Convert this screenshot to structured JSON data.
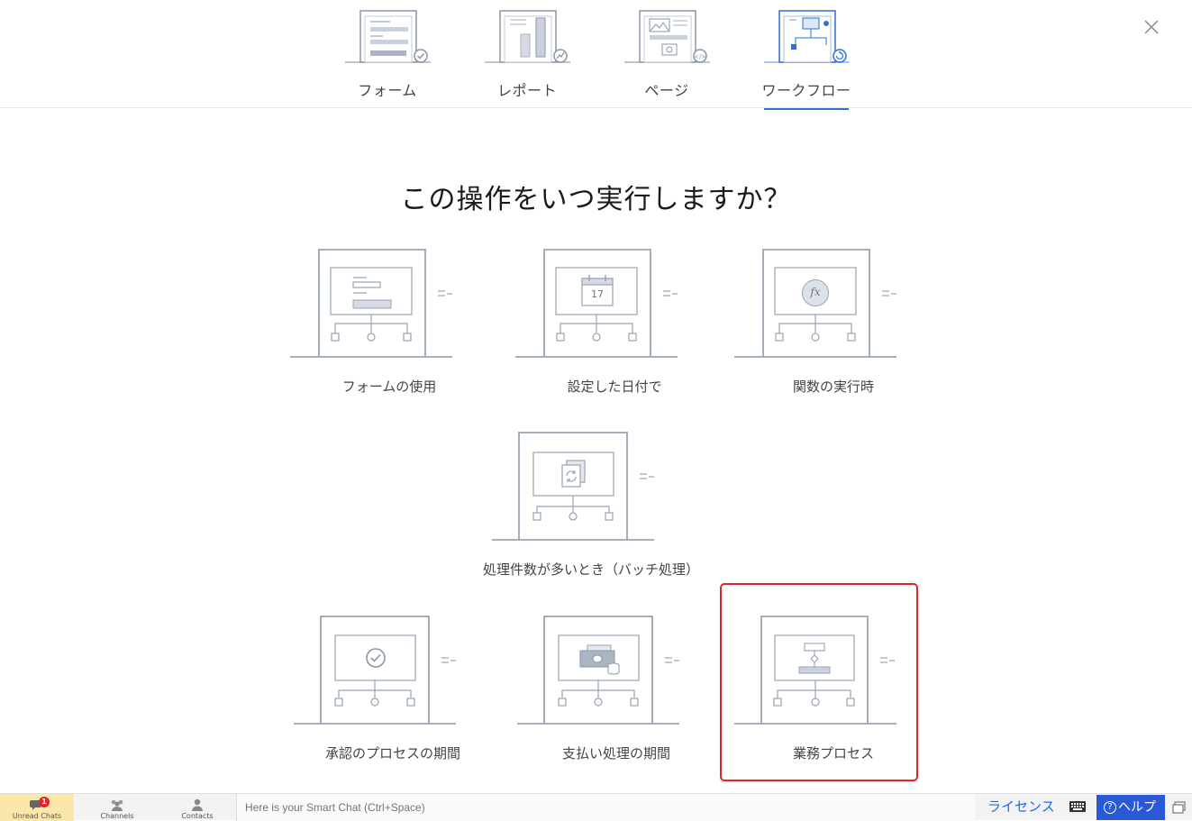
{
  "tabs": [
    {
      "label": "フォーム",
      "icon": "form-icon",
      "active": false
    },
    {
      "label": "レポート",
      "icon": "report-icon",
      "active": false
    },
    {
      "label": "ページ",
      "icon": "page-icon",
      "active": false
    },
    {
      "label": "ワークフロー",
      "icon": "workflow-icon",
      "active": true
    }
  ],
  "title": "この操作をいつ実行しますか？",
  "cards": [
    {
      "label": "フォームの使用",
      "icon": "form-usage-icon"
    },
    {
      "label": "設定した日付で",
      "icon": "calendar-icon",
      "calendar_day": "17"
    },
    {
      "label": "関数の実行時",
      "icon": "function-icon",
      "function_symbol": "fx"
    },
    {
      "label": "処理件数が多いとき（バッチ処理）",
      "icon": "batch-refresh-icon"
    },
    {
      "label": "承認のプロセスの期間",
      "icon": "approval-check-icon"
    },
    {
      "label": "支払い処理の期間",
      "icon": "payment-money-icon"
    },
    {
      "label": "業務プロセス",
      "icon": "business-process-icon",
      "highlighted": true
    }
  ],
  "bottombar": {
    "unread_label": "Unread Chats",
    "unread_count": "1",
    "channels_label": "Channels",
    "contacts_label": "Contacts",
    "chat_placeholder": "Here is your Smart Chat (Ctrl+Space)",
    "license_label": "ライセンス",
    "help_label": "ヘルプ"
  },
  "colors": {
    "accent": "#2f6fd6",
    "highlight": "#e0262b",
    "help_button": "#2a59d8",
    "unread_bg": "#fae7a9",
    "icon_stroke": "#8a96a8"
  }
}
